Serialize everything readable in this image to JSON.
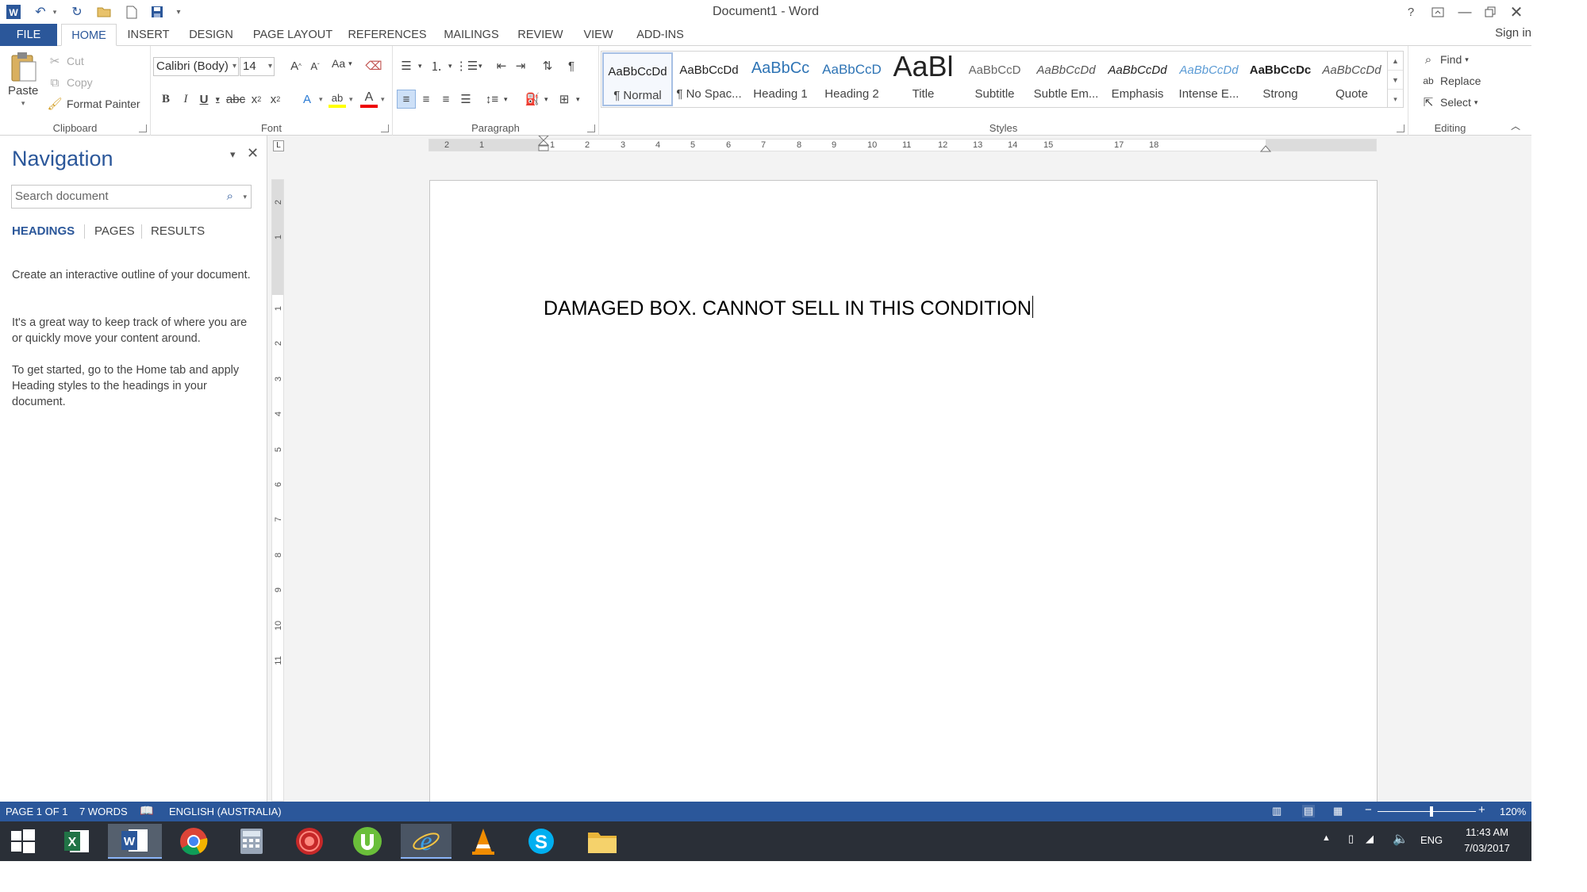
{
  "window": {
    "title": "Document1 - Word",
    "help": "?",
    "sign_in": "Sign in"
  },
  "tabs": [
    "FILE",
    "HOME",
    "INSERT",
    "DESIGN",
    "PAGE LAYOUT",
    "REFERENCES",
    "MAILINGS",
    "REVIEW",
    "VIEW",
    "ADD-INS"
  ],
  "ribbon": {
    "clipboard": {
      "label": "Clipboard",
      "paste": "Paste",
      "cut": "Cut",
      "copy": "Copy",
      "format_painter": "Format Painter"
    },
    "font": {
      "label": "Font",
      "family": "Calibri (Body)",
      "size": "14",
      "change_case": "Aa"
    },
    "paragraph": {
      "label": "Paragraph"
    },
    "styles": {
      "label": "Styles",
      "items": [
        {
          "sample": "AaBbCcDd",
          "name": "¶ Normal"
        },
        {
          "sample": "AaBbCcDd",
          "name": "¶ No Spac..."
        },
        {
          "sample": "AaBbCc",
          "name": "Heading 1"
        },
        {
          "sample": "AaBbCcD",
          "name": "Heading 2"
        },
        {
          "sample": "AaBl",
          "name": "Title"
        },
        {
          "sample": "AaBbCcD",
          "name": "Subtitle"
        },
        {
          "sample": "AaBbCcDd",
          "name": "Subtle Em..."
        },
        {
          "sample": "AaBbCcDd",
          "name": "Emphasis"
        },
        {
          "sample": "AaBbCcDd",
          "name": "Intense E..."
        },
        {
          "sample": "AaBbCcDc",
          "name": "Strong"
        },
        {
          "sample": "AaBbCcDd",
          "name": "Quote"
        }
      ]
    },
    "editing": {
      "label": "Editing",
      "find": "Find",
      "replace": "Replace",
      "select": "Select"
    }
  },
  "navigation": {
    "title": "Navigation",
    "search_placeholder": "Search document",
    "tabs": [
      "HEADINGS",
      "PAGES",
      "RESULTS"
    ],
    "p1": "Create an interactive outline of your document.",
    "p2": "It's a great way to keep track of where you are or quickly move your content around.",
    "p3": "To get started, go to the Home tab and apply Heading styles to the headings in your document."
  },
  "ruler": {
    "h_ticks": [
      "2",
      "1",
      "1",
      "2",
      "3",
      "4",
      "5",
      "6",
      "7",
      "8",
      "9",
      "10",
      "11",
      "12",
      "13",
      "14",
      "15",
      "17",
      "18"
    ],
    "v_ticks": [
      "2",
      "1",
      "1",
      "2",
      "3",
      "4",
      "5",
      "6",
      "7",
      "8",
      "9",
      "10",
      "11"
    ],
    "tab_selector": "L"
  },
  "document": {
    "text": "DAMAGED BOX. CANNOT SELL IN THIS CONDITION"
  },
  "status": {
    "page": "PAGE 1 OF 1",
    "words": "7 WORDS",
    "language": "ENGLISH (AUSTRALIA)",
    "zoom": "120%",
    "zoom_fraction": 0.55
  },
  "taskbar": {
    "apps": [
      "start",
      "excel",
      "word",
      "chrome",
      "calculator",
      "media-app",
      "utorrent",
      "internet-explorer",
      "vlc",
      "skype",
      "file-explorer"
    ],
    "lang": "ENG",
    "time": "11:43 AM",
    "date": "7/03/2017"
  },
  "colors": {
    "accent": "#2b579a",
    "taskbar": "#2a2f37"
  }
}
